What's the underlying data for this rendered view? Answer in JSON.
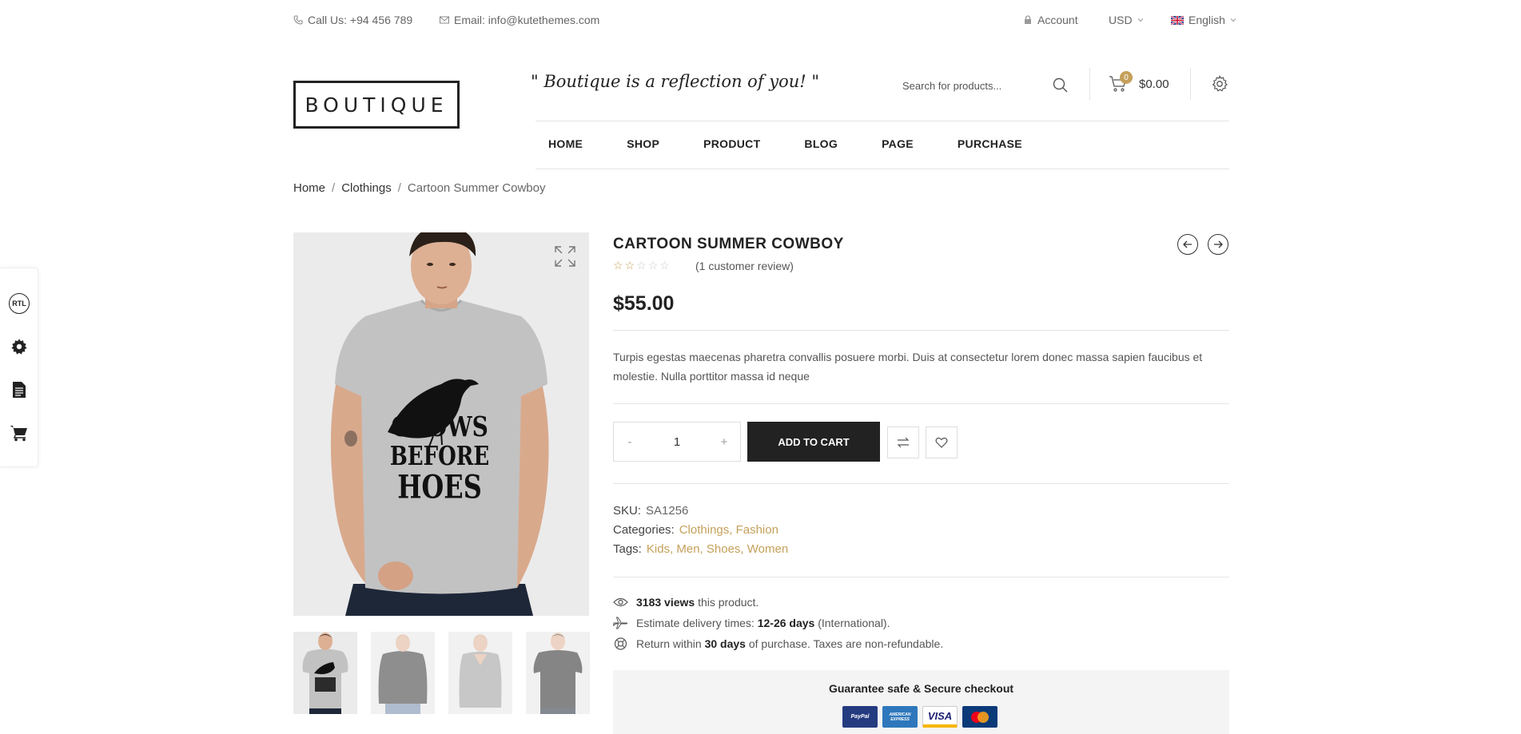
{
  "topbar": {
    "phone": "Call Us: +94 456 789",
    "email": "Email: info@kutethemes.com",
    "account": "Account",
    "currency": "USD",
    "language": "English"
  },
  "header": {
    "logo": "BOUTIQUE",
    "tagline": "\" Boutique is a reflection of you! \"",
    "search_placeholder": "Search for products...",
    "cart_count": "0",
    "cart_total": "$0.00"
  },
  "nav": [
    "HOME",
    "SHOP",
    "PRODUCT",
    "BLOG",
    "PAGE",
    "PURCHASE"
  ],
  "breadcrumb": {
    "home": "Home",
    "category": "Clothings",
    "current": "Cartoon Summer Cowboy",
    "sep": "/"
  },
  "sidebar_tools": {
    "rtl": "RTL"
  },
  "product": {
    "title": "CARTOON SUMMER COWBOY",
    "rating": 2,
    "rating_max": 5,
    "review_text": "(1 customer review)",
    "price": "$55.00",
    "description": "Turpis egestas maecenas pharetra convallis posuere morbi. Duis at consectetur lorem donec massa sapien faucibus et molestie. Nulla porttitor massa id neque",
    "quantity": "1",
    "qty_minus": "-",
    "qty_plus": "+",
    "add_to_cart": "ADD TO CART",
    "sku_label": "SKU:",
    "sku": "SA1256",
    "categories_label": "Categories:",
    "categories": "Clothings, Fashion",
    "tags_label": "Tags:",
    "tags": "Kids, Men, Shoes, Women",
    "shirt_text_1": "CROWS",
    "shirt_text_2": "BEFORE",
    "shirt_text_3": "HOES"
  },
  "info": {
    "views_count": "3183 views",
    "views_suffix": "this product.",
    "delivery_prefix": "Estimate delivery times:",
    "delivery_days": "12-26 days",
    "delivery_suffix": "(International).",
    "return_prefix": "Return within",
    "return_days": "30 days",
    "return_suffix": "of purchase. Taxes are non-refundable."
  },
  "guarantee": {
    "title": "Guarantee safe & Secure checkout",
    "cards": [
      "PayPal",
      "AMERICAN EXPRESS",
      "VISA",
      "MasterCard"
    ]
  },
  "colors": {
    "accent": "#c5a05a",
    "dark": "#222222"
  }
}
